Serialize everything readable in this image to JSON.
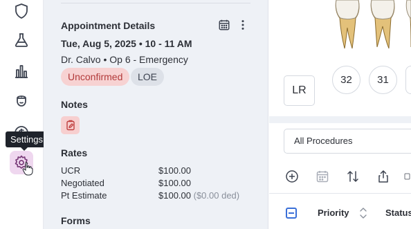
{
  "sidebar": {
    "tooltip": "Settings",
    "items": [
      {
        "icon": "shield-icon"
      },
      {
        "icon": "flask-icon"
      },
      {
        "icon": "chart-bars-icon"
      },
      {
        "icon": "nurse-icon"
      },
      {
        "icon": "dollar-icon"
      },
      {
        "icon": "gear-icon",
        "active": true
      }
    ]
  },
  "appointment": {
    "section_title": "Appointment Details",
    "date_time": "Tue, Aug 5, 2025 • 10 - 11 AM",
    "provider": "Dr. Calvo • Op 6 - Emergency",
    "badges": [
      "Unconfirmed",
      "LOE"
    ]
  },
  "notes": {
    "title": "Notes"
  },
  "rates": {
    "title": "Rates",
    "rows": [
      {
        "label": "UCR",
        "value": "$100.00",
        "extra": ""
      },
      {
        "label": "Negotiated",
        "value": "$100.00",
        "extra": ""
      },
      {
        "label": "Pt Estimate",
        "value": "$100.00",
        "extra": " ($0.00 ded)"
      }
    ]
  },
  "forms": {
    "title": "Forms"
  },
  "chart": {
    "quadrant": "LR",
    "teeth": [
      "32",
      "31"
    ]
  },
  "procedures": {
    "filter_value": "All Procedures"
  },
  "table": {
    "columns": [
      "Priority",
      "Status"
    ]
  },
  "colors": {
    "accent": "#3a6fd8",
    "badge_unconfirmed": "#f7d2d2",
    "active_rail": "#efd7ef"
  }
}
